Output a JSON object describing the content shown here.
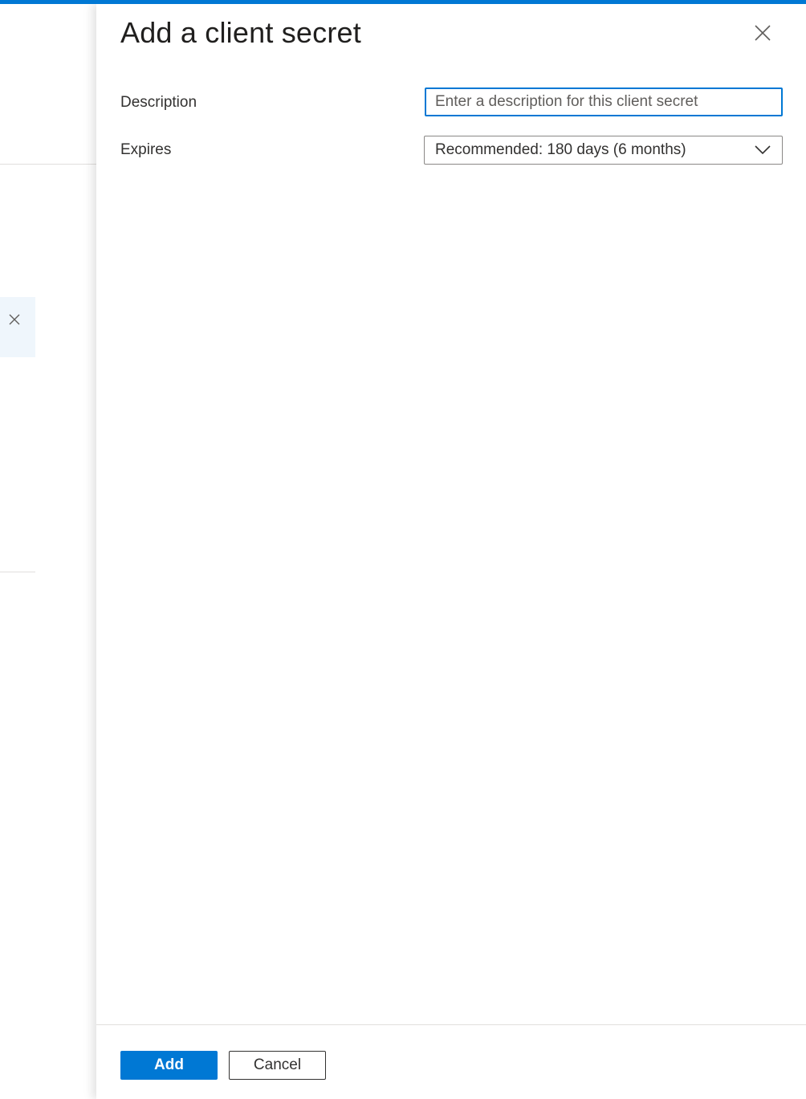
{
  "panel": {
    "title": "Add a client secret"
  },
  "form": {
    "description_label": "Description",
    "description_placeholder": "Enter a description for this client secret",
    "description_value": "",
    "expires_label": "Expires",
    "expires_value": "Recommended: 180 days (6 months)"
  },
  "footer": {
    "add_label": "Add",
    "cancel_label": "Cancel"
  },
  "icons": {
    "panel_close": "close-icon",
    "notice_close": "close-icon",
    "dropdown": "chevron-down-icon"
  },
  "colors": {
    "accent": "#0078d4",
    "notice_background": "#eff6fc"
  }
}
